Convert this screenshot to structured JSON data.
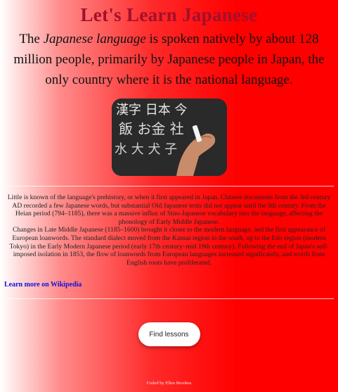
{
  "page": {
    "title": "Let's Learn Japanese",
    "intro_before": "The ",
    "intro_em": "Japanese language",
    "intro_after": " is spoken natively by about 128 million people, primarily by Japanese people in Japan, the only country where it is the national language."
  },
  "photo": {
    "glyphs_top": "漢字 日本 今",
    "glyphs_mid": "飯 お金 社",
    "glyphs_low": "水 大 犬 子"
  },
  "history": {
    "paragraph_1": "Little is known of the language's prehistory, or when it first appeared in Japan. Chinese documents from the 3rd century AD recorded a few Japanese words, but substantial Old Japanese texts did not appear until the 8th century. From the Heian period (794–1185), there was a massive influx of Sino-Japanese vocabulary into the language, affecting the phonology of Early Middle Japanese.",
    "paragraph_2": "Changes in Late Middle Japanese (1185–1600) brought it closer to the modern language, and the first appearance of European loanwords. The standard dialect moved from the Kansai region in the south, up to the Edo region (modern Tokyo) in the Early Modern Japanese period (early 17th century–mid 19th century). Following the end of Japan's self-imposed isolation in 1853, the flow of loanwords from European languages increased significantly, and words from English roots have proliferated."
  },
  "links": {
    "wikipedia": "Learn more on Wikipedia"
  },
  "actions": {
    "find_lessons": "Find lessons"
  },
  "footer": {
    "credit": "Coded by Ellen Brookes"
  }
}
